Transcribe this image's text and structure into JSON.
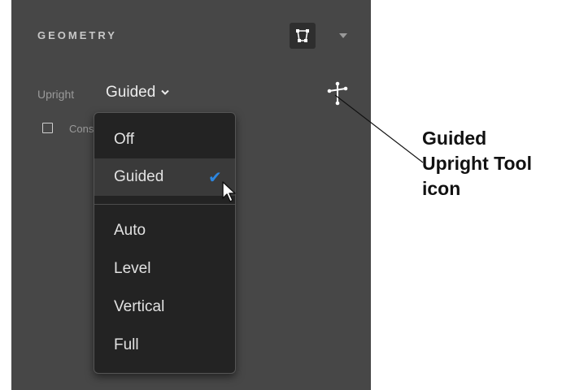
{
  "panel": {
    "title": "GEOMETRY",
    "upright_label": "Upright",
    "upright_value": "Guided",
    "constrain_label": "Constrain Crop"
  },
  "dropdown": {
    "items": [
      {
        "label": "Off"
      },
      {
        "label": "Guided",
        "selected": true
      },
      {
        "label": "Auto"
      },
      {
        "label": "Level"
      },
      {
        "label": "Vertical"
      },
      {
        "label": "Full"
      }
    ]
  },
  "callout": {
    "lines": [
      "Guided",
      "Upright Tool",
      "icon"
    ]
  },
  "colors": {
    "panel_bg": "#474747",
    "menu_bg": "#232323",
    "selected_bg": "#3a3a3a",
    "check_accent": "#2c86e0"
  },
  "icons": {
    "geometry_button": "grid-warp-icon",
    "panel_menu": "chevron-down-icon",
    "upright_dropdown": "chevron-down-icon",
    "guided_tool": "guided-upright-tool-icon",
    "selected_mark": "checkmark-icon",
    "pointer": "mouse-cursor-icon"
  }
}
